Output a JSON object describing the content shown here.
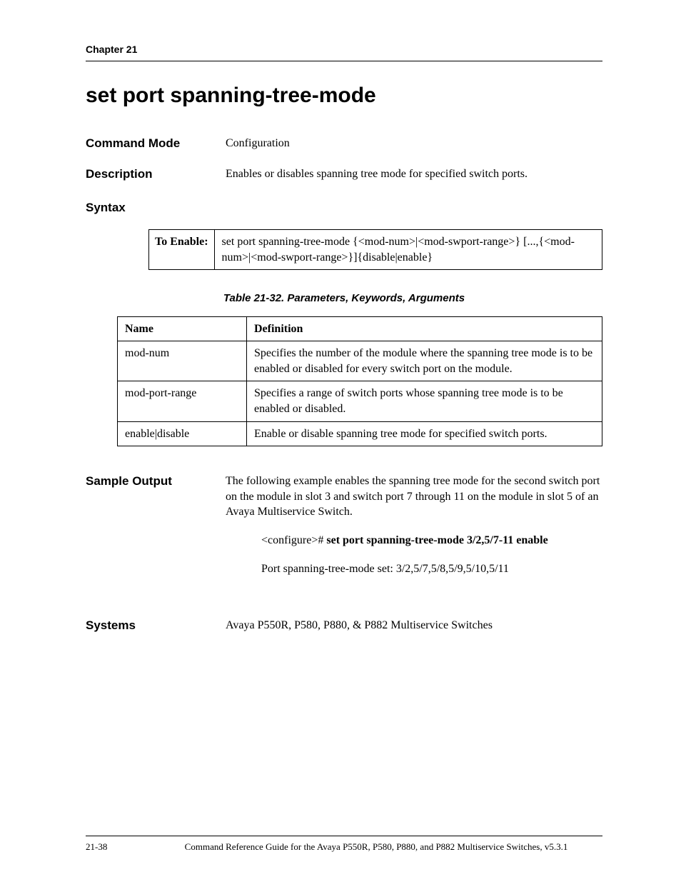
{
  "chapter": "Chapter 21",
  "title": "set port spanning-tree-mode",
  "fields": {
    "commandMode": {
      "label": "Command Mode",
      "value": "Configuration"
    },
    "description": {
      "label": "Description",
      "value": "Enables or disables spanning tree mode for specified switch ports."
    }
  },
  "syntax": {
    "heading": "Syntax",
    "rowLabel": "To Enable:",
    "text": "set port spanning-tree-mode {<mod-num>|<mod-swport-range>} [...,{<mod-num>|<mod-swport-range>}]{disable|enable}"
  },
  "tableCaption": "Table 21-32.  Parameters, Keywords, Arguments",
  "paramsHeaders": {
    "name": "Name",
    "definition": "Definition"
  },
  "params": [
    {
      "name": "mod-num",
      "definition": "Specifies the number of the module where the spanning tree mode is to be enabled or disabled for every switch port on the module."
    },
    {
      "name": "mod-port-range",
      "definition": "Specifies a range of switch ports whose spanning tree mode is to be enabled or disabled."
    },
    {
      "name": "enable|disable",
      "definition": "Enable or disable spanning tree mode for specified switch ports."
    }
  ],
  "sampleOutput": {
    "label": "Sample Output",
    "intro": "The following example enables the spanning tree mode for the second switch port on the module in slot 3 and switch port 7 through 11 on the module in slot 5 of an Avaya Multiservice Switch.",
    "promptPrefix": "<configure># ",
    "command": "set port spanning-tree-mode 3/2,5/7-11 enable",
    "result": "Port spanning-tree-mode set: 3/2,5/7,5/8,5/9,5/10,5/11"
  },
  "systems": {
    "label": "Systems",
    "value": "Avaya P550R, P580, P880, & P882 Multiservice Switches"
  },
  "footer": {
    "page": "21-38",
    "text": "Command Reference Guide for the Avaya P550R, P580, P880, and P882 Multiservice Switches, v5.3.1"
  }
}
